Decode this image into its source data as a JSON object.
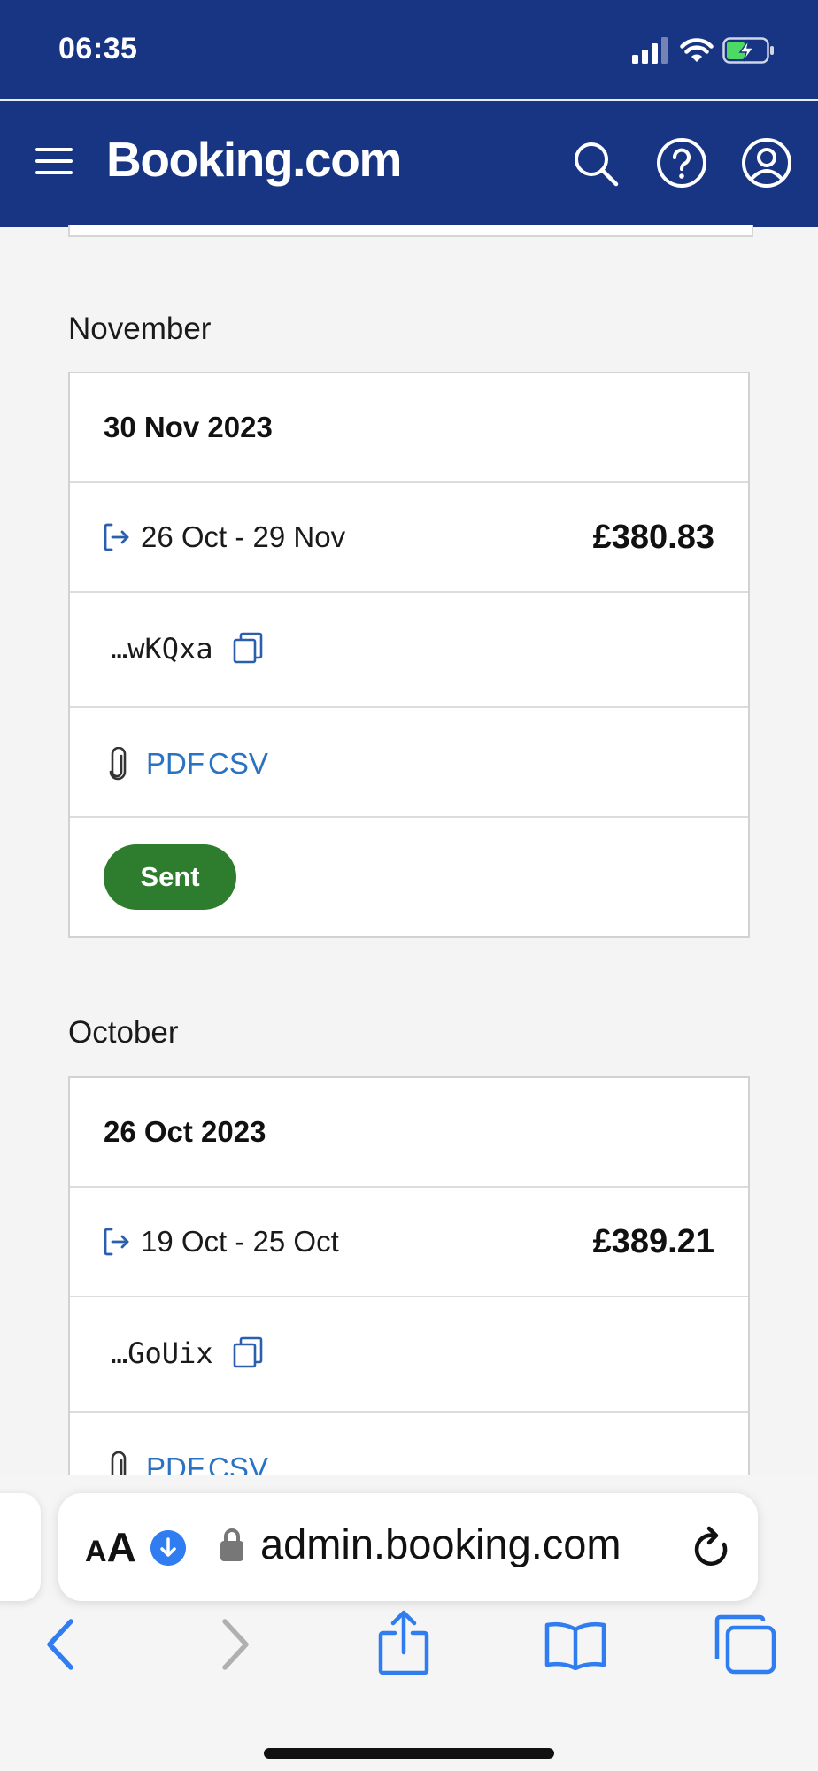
{
  "status_bar": {
    "time": "06:35"
  },
  "header": {
    "brand": "Booking.com"
  },
  "statements": [
    {
      "month": "November",
      "date": "30 Nov 2023",
      "period": "26 Oct - 29 Nov",
      "amount": "£380.83",
      "reference": "…wKQxa",
      "files": [
        "PDF",
        "CSV"
      ],
      "status": "Sent"
    },
    {
      "month": "October",
      "date": "26 Oct 2023",
      "period": "19 Oct - 25 Oct",
      "amount": "£389.21",
      "reference": "…GoUix",
      "files": [
        "PDF",
        "CSV"
      ]
    }
  ],
  "browser": {
    "reader_label_small": "A",
    "reader_label_large": "A",
    "url": "admin.booking.com"
  },
  "colors": {
    "brand_blue": "#183584",
    "link_blue": "#2a72c2",
    "sent_green": "#2e7d2e",
    "safari_blue": "#2f7df0"
  }
}
